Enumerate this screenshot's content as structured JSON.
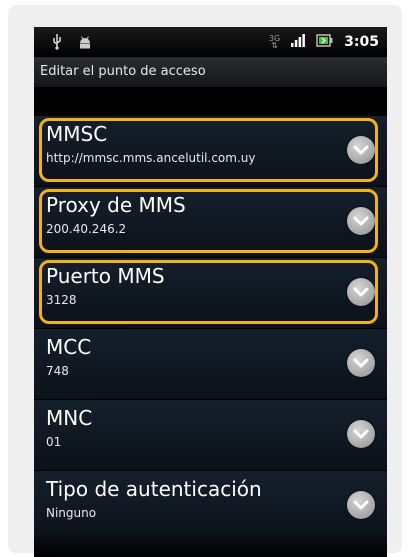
{
  "status": {
    "time": "3:05",
    "network": "3G"
  },
  "header": {
    "title": "Editar el punto de acceso"
  },
  "settings": [
    {
      "label": "MMSC",
      "value": "http://mmsc.mms.ancelutil.com.uy",
      "highlighted": true
    },
    {
      "label": "Proxy de MMS",
      "value": "200.40.246.2",
      "highlighted": true
    },
    {
      "label": "Puerto MMS",
      "value": "3128",
      "highlighted": true
    },
    {
      "label": "MCC",
      "value": "748",
      "highlighted": false
    },
    {
      "label": "MNC",
      "value": "01",
      "highlighted": false
    },
    {
      "label": "Tipo de autenticación",
      "value": "Ninguno",
      "highlighted": false
    }
  ],
  "colors": {
    "highlight": "#f2b21b",
    "row_background": "#15202d"
  }
}
